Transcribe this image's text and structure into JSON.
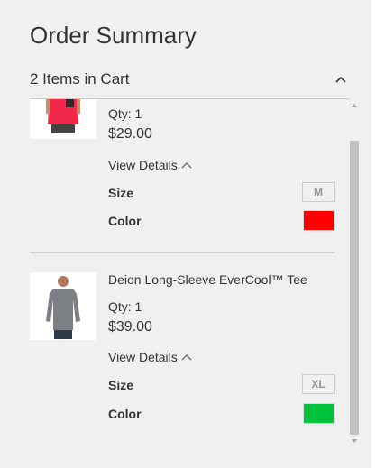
{
  "summary": {
    "title": "Order Summary",
    "cart_count": "2 Items in Cart"
  },
  "items": [
    {
      "image": "red-tank-top-photo",
      "qty": "Qty: 1",
      "price": "$29.00",
      "view_details": "View Details",
      "size_label": "Size",
      "size_value": "M",
      "color_label": "Color",
      "color_value": "#ff0000"
    },
    {
      "image": "gray-long-sleeve-tee-photo",
      "name": "Deion Long-Sleeve EverCool™ Tee",
      "qty": "Qty: 1",
      "price": "$39.00",
      "view_details": "View Details",
      "size_label": "Size",
      "size_value": "XL",
      "color_label": "Color",
      "color_value": "#00c33b"
    }
  ],
  "colors": {
    "panel_bg": "#f0f0f0",
    "divider": "#cccccc",
    "text": "#333333",
    "scrollbar_thumb": "#c1c1c1"
  }
}
